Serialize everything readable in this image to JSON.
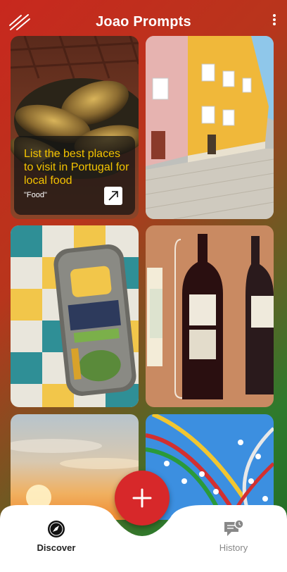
{
  "header": {
    "title": "Joao Prompts"
  },
  "featured": {
    "title": "List the best places to visit in Portugal for local food",
    "tag": "\"Food\""
  },
  "nav": {
    "discover": "Discover",
    "history": "History"
  },
  "colors": {
    "accent": "#d7282a",
    "tag_yellow": "#f3c300"
  },
  "icons": [
    "menu-icon",
    "more-vertical-icon",
    "external-link-icon",
    "compass-icon",
    "plus-icon",
    "history-icon"
  ]
}
